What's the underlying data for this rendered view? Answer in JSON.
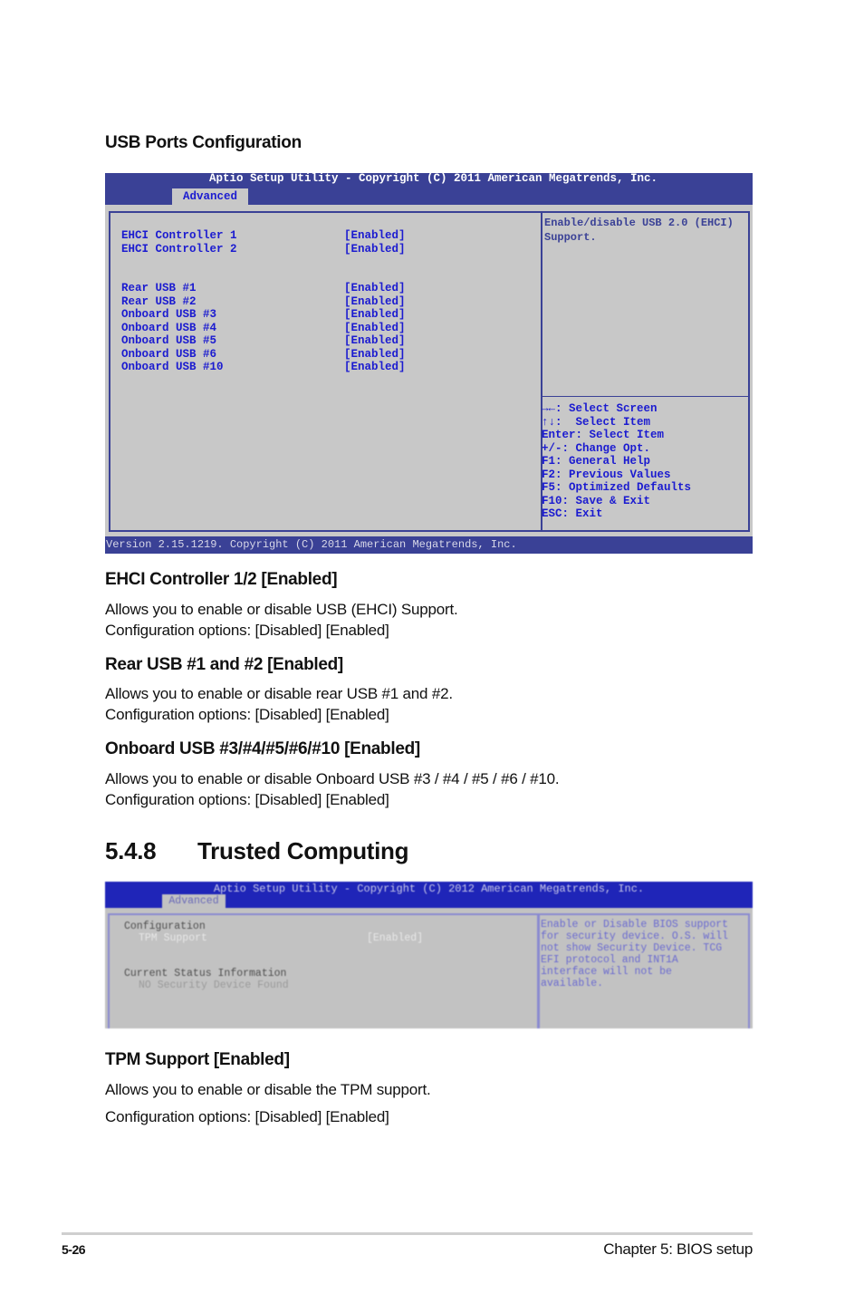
{
  "usb_section": {
    "heading": "USB Ports Configuration",
    "bios": {
      "title": "Aptio Setup Utility - Copyright (C) 2011 American Megatrends, Inc.",
      "active_tab": "Advanced",
      "items": [
        {
          "label": "EHCI Controller 1",
          "value": "[Enabled]"
        },
        {
          "label": "EHCI Controller 2",
          "value": "[Enabled]"
        },
        {
          "label": "Rear USB #1",
          "value": "[Enabled]"
        },
        {
          "label": "Rear USB #2",
          "value": "[Enabled]"
        },
        {
          "label": "Onboard USB #3",
          "value": "[Enabled]"
        },
        {
          "label": "Onboard USB #4",
          "value": "[Enabled]"
        },
        {
          "label": "Onboard USB #5",
          "value": "[Enabled]"
        },
        {
          "label": "Onboard USB #6",
          "value": "[Enabled]"
        },
        {
          "label": "Onboard USB #10",
          "value": "[Enabled]"
        }
      ],
      "help_text": "Enable/disable USB 2.0 (EHCI)\nSupport.",
      "keys": [
        "→←: Select Screen",
        "↑↓:  Select Item",
        "Enter: Select Item",
        "+/-: Change Opt.",
        "F1: General Help",
        "F2: Previous Values",
        "F5: Optimized Defaults",
        "F10: Save & Exit",
        "ESC: Exit"
      ],
      "version": "Version 2.15.1219. Copyright (C) 2011 American Megatrends, Inc."
    },
    "subsections": [
      {
        "heading": "EHCI Controller 1/2 [Enabled]",
        "line1": "Allows you to enable or disable USB (EHCI) Support.",
        "line2": "Configuration options: [Disabled] [Enabled]"
      },
      {
        "heading": "Rear USB #1 and #2 [Enabled]",
        "line1": "Allows you to enable or disable rear USB #1 and #2.",
        "line2": "Configuration options: [Disabled] [Enabled]"
      },
      {
        "heading": "Onboard USB #3/#4/#5/#6/#10 [Enabled]",
        "line1": "Allows you to enable or disable Onboard USB #3 / #4 / #5 / #6 / #10.",
        "line2": "Configuration options: [Disabled] [Enabled]"
      }
    ]
  },
  "trusted_section": {
    "number": "5.4.8",
    "title": "Trusted Computing",
    "bios": {
      "title": "Aptio Setup Utility - Copyright (C) 2012 American Megatrends, Inc.",
      "active_tab": "Advanced",
      "config_label": "Configuration",
      "tpm_label": "TPM Support",
      "tpm_value": "[Enabled]",
      "status_label": "Current Status Information",
      "status_value": "NO Security Device Found",
      "help_text": "Enable or Disable BIOS support\nfor security device. O.S. will\nnot show Security Device. TCG\nEFI protocol and INT1A\ninterface will not be\navailable."
    },
    "subsection": {
      "heading": "TPM Support [Enabled]",
      "line1": "Allows you to enable or disable the TPM support.",
      "line2": "Configuration options: [Disabled] [Enabled]"
    }
  },
  "footer": {
    "page_number": "5-26",
    "chapter": "Chapter 5: BIOS setup"
  }
}
